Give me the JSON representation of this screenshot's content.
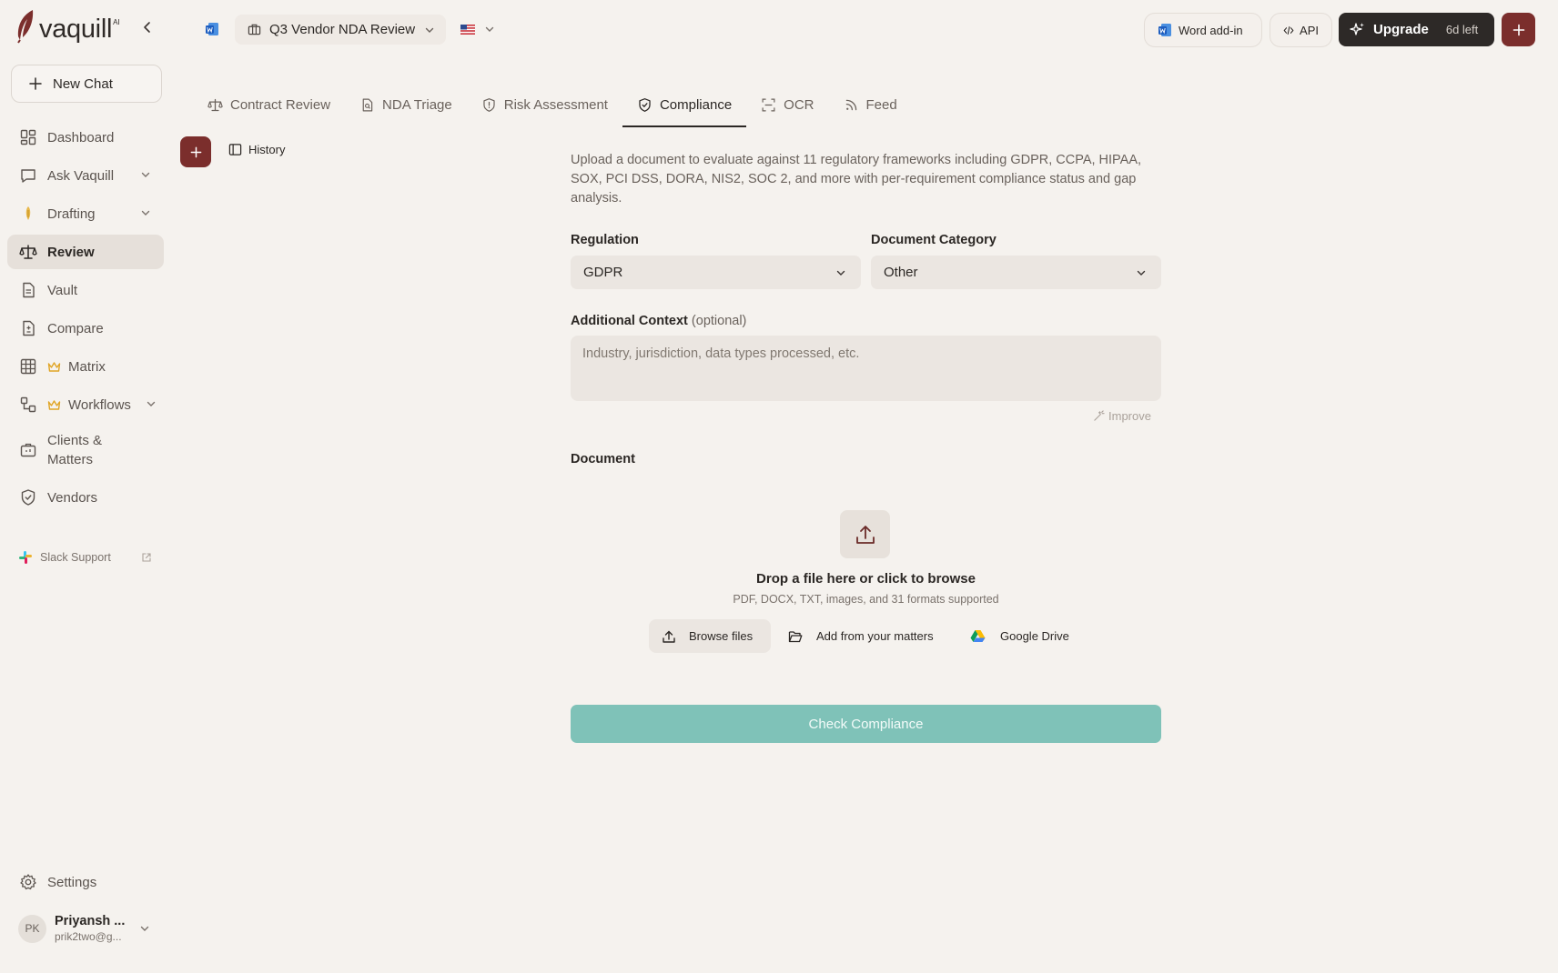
{
  "app": {
    "logo_text": "vaquill",
    "logo_badge": "AI"
  },
  "sidebar": {
    "new_chat": "New Chat",
    "items": [
      {
        "label": "Dashboard"
      },
      {
        "label": "Ask Vaquill"
      },
      {
        "label": "Drafting"
      },
      {
        "label": "Review"
      },
      {
        "label": "Vault"
      },
      {
        "label": "Compare"
      },
      {
        "label": "Matrix"
      },
      {
        "label": "Workflows"
      },
      {
        "label": "Clients & Matters"
      },
      {
        "label": "Vendors"
      }
    ],
    "slack_support": "Slack Support",
    "settings": "Settings",
    "user": {
      "initials": "PK",
      "name": "Priyansh ...",
      "email": "prik2two@g..."
    }
  },
  "topbar": {
    "project_name": "Q3 Vendor NDA Review",
    "word_addin": "Word add-in",
    "api": "API",
    "upgrade": "Upgrade",
    "days_left": "6d left"
  },
  "tabs": [
    {
      "label": "Contract Review"
    },
    {
      "label": "NDA Triage"
    },
    {
      "label": "Risk Assessment"
    },
    {
      "label": "Compliance",
      "active": true
    },
    {
      "label": "OCR"
    },
    {
      "label": "Feed"
    }
  ],
  "history_label": "History",
  "form": {
    "intro": "Upload a document to evaluate against 11 regulatory frameworks including GDPR, CCPA, HIPAA, SOX, PCI DSS, DORA, NIS2, SOC 2, and more with per-requirement compliance status and gap analysis.",
    "regulation_label": "Regulation",
    "regulation_value": "GDPR",
    "category_label": "Document Category",
    "category_value": "Other",
    "context_label": "Additional Context",
    "context_optional": "(optional)",
    "context_placeholder": "Industry, jurisdiction, data types processed, etc.",
    "improve": "Improve",
    "document_label": "Document",
    "drop_title": "Drop a file here or click to browse",
    "drop_subtitle": "PDF, DOCX, TXT, images, and 31 formats supported",
    "browse_files": "Browse files",
    "add_matters": "Add from your matters",
    "google_drive": "Google Drive",
    "submit": "Check Compliance"
  },
  "colors": {
    "brand": "#7b2e2c",
    "submit_disabled": "#7fc2b8",
    "upgrade_bg": "#2d2927",
    "active_nav_bg": "#e6e0da"
  }
}
